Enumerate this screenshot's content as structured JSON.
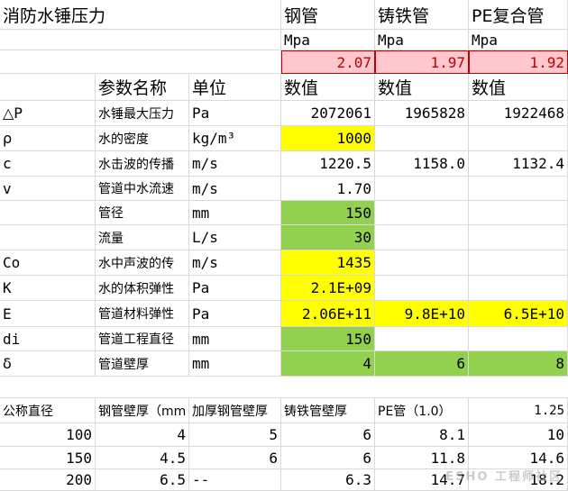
{
  "title": "消防水锤压力",
  "materials": [
    "钢管",
    "铸铁管",
    "PE复合管"
  ],
  "unit_label": "Mpa",
  "pressure_mpa": [
    "2.07",
    "1.97",
    "1.92"
  ],
  "header": {
    "param": "参数名称",
    "unit": "单位",
    "val": "数值"
  },
  "rows": [
    {
      "sym": "△P",
      "name": "水锤最大压力",
      "unit": "Pa",
      "v1": "2072061",
      "v2": "1965828",
      "v3": "1922468"
    },
    {
      "sym": "ρ",
      "name": "水的密度",
      "unit": "kg/m³",
      "v1": "1000",
      "v2": "",
      "v3": ""
    },
    {
      "sym": "c",
      "name": "水击波的传播",
      "unit": "m/s",
      "v1": "1220.5",
      "v2": "1158.0",
      "v3": "1132.4"
    },
    {
      "sym": "v",
      "name": "管道中水流速",
      "unit": "m/s",
      "v1": "1.70",
      "v2": "",
      "v3": ""
    },
    {
      "sym": "",
      "name": "管径",
      "unit": "mm",
      "v1": "150",
      "v2": "",
      "v3": ""
    },
    {
      "sym": "",
      "name": "流量",
      "unit": "L/s",
      "v1": "30",
      "v2": "",
      "v3": ""
    },
    {
      "sym": "Co",
      "name": "水中声波的传",
      "unit": "m/s",
      "v1": "1435",
      "v2": "",
      "v3": ""
    },
    {
      "sym": "K",
      "name": "水的体积弹性",
      "unit": "Pa",
      "v1": "2.1E+09",
      "v2": "",
      "v3": ""
    },
    {
      "sym": "E",
      "name": "管道材料弹性",
      "unit": "Pa",
      "v1": "2.06E+11",
      "v2": "9.8E+10",
      "v3": "6.5E+10"
    },
    {
      "sym": "di",
      "name": "管道工程直径",
      "unit": "mm",
      "v1": "150",
      "v2": "",
      "v3": ""
    },
    {
      "sym": "δ",
      "name": "管道壁厚",
      "unit": "mm",
      "v1": "4",
      "v2": "6",
      "v3": "8"
    }
  ],
  "bottom": {
    "headers": [
      "公称直径",
      "钢管壁厚（mm",
      "加厚钢管壁厚",
      "铸铁管壁厚",
      "PE管（1.0）",
      "1.25"
    ],
    "rows": [
      [
        "100",
        "4",
        "5",
        "6",
        "8.1",
        "10"
      ],
      [
        "150",
        "4.5",
        "6",
        "6",
        "11.8",
        "14.6"
      ],
      [
        "200",
        "6.5",
        "--",
        "6.3",
        "14.7",
        "18.2"
      ]
    ]
  },
  "watermark": "ESHO 工程师社区"
}
